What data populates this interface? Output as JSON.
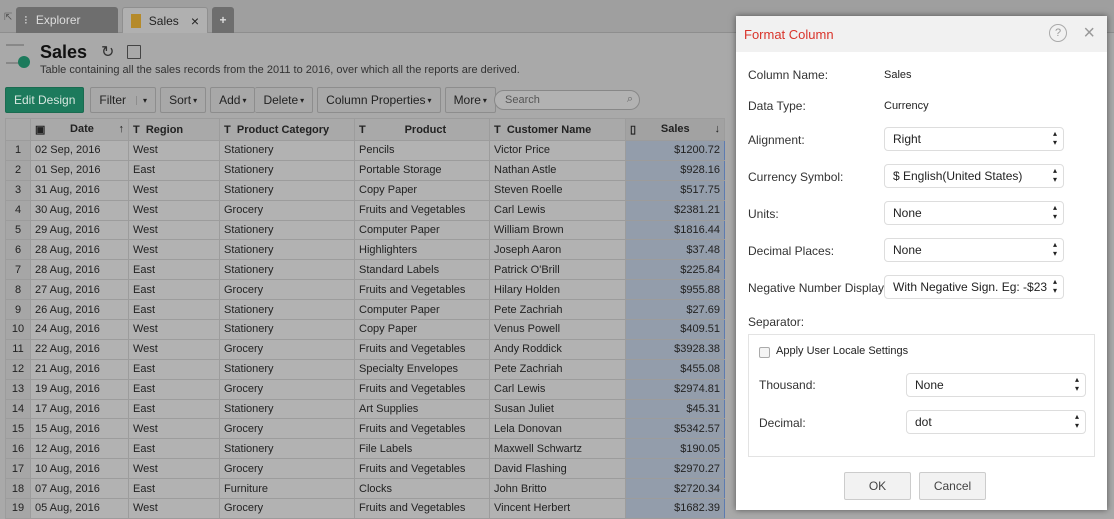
{
  "tabs": {
    "explorer": "Explorer",
    "sales": "Sales",
    "close": "×",
    "add": "+"
  },
  "header": {
    "title": "Sales",
    "description": "Table containing all the sales records from the 2011 to 2016, over which all the reports are derived."
  },
  "toolbar": {
    "edit_design": "Edit Design",
    "filter": "Filter",
    "sort": "Sort",
    "add": "Add",
    "delete": "Delete",
    "column_properties": "Column Properties",
    "more": "More",
    "search_placeholder": "Search"
  },
  "table": {
    "columns": [
      "Date",
      "Region",
      "Product Category",
      "Product",
      "Customer Name",
      "Sales"
    ],
    "rows": [
      [
        "1",
        "02 Sep, 2016",
        "West",
        "Stationery",
        "Pencils",
        "Victor Price",
        "$1200.72"
      ],
      [
        "2",
        "01 Sep, 2016",
        "East",
        "Stationery",
        "Portable Storage",
        "Nathan Astle",
        "$928.16"
      ],
      [
        "3",
        "31 Aug, 2016",
        "West",
        "Stationery",
        "Copy Paper",
        "Steven Roelle",
        "$517.75"
      ],
      [
        "4",
        "30 Aug, 2016",
        "West",
        "Grocery",
        "Fruits and Vegetables",
        "Carl Lewis",
        "$2381.21"
      ],
      [
        "5",
        "29 Aug, 2016",
        "West",
        "Stationery",
        "Computer Paper",
        "William Brown",
        "$1816.44"
      ],
      [
        "6",
        "28 Aug, 2016",
        "West",
        "Stationery",
        "Highlighters",
        "Joseph Aaron",
        "$37.48"
      ],
      [
        "7",
        "28 Aug, 2016",
        "East",
        "Stationery",
        "Standard Labels",
        "Patrick O'Brill",
        "$225.84"
      ],
      [
        "8",
        "27 Aug, 2016",
        "East",
        "Grocery",
        "Fruits and Vegetables",
        "Hilary Holden",
        "$955.88"
      ],
      [
        "9",
        "26 Aug, 2016",
        "East",
        "Stationery",
        "Computer Paper",
        "Pete Zachriah",
        "$27.69"
      ],
      [
        "10",
        "24 Aug, 2016",
        "West",
        "Stationery",
        "Copy Paper",
        "Venus Powell",
        "$409.51"
      ],
      [
        "11",
        "22 Aug, 2016",
        "West",
        "Grocery",
        "Fruits and Vegetables",
        "Andy Roddick",
        "$3928.38"
      ],
      [
        "12",
        "21 Aug, 2016",
        "East",
        "Stationery",
        "Specialty Envelopes",
        "Pete Zachriah",
        "$455.08"
      ],
      [
        "13",
        "19 Aug, 2016",
        "East",
        "Grocery",
        "Fruits and Vegetables",
        "Carl Lewis",
        "$2974.81"
      ],
      [
        "14",
        "17 Aug, 2016",
        "East",
        "Stationery",
        "Art Supplies",
        "Susan Juliet",
        "$45.31"
      ],
      [
        "15",
        "15 Aug, 2016",
        "West",
        "Grocery",
        "Fruits and Vegetables",
        "Lela Donovan",
        "$5342.57"
      ],
      [
        "16",
        "12 Aug, 2016",
        "East",
        "Stationery",
        "File Labels",
        "Maxwell Schwartz",
        "$190.05"
      ],
      [
        "17",
        "10 Aug, 2016",
        "West",
        "Grocery",
        "Fruits and Vegetables",
        "David Flashing",
        "$2970.27"
      ],
      [
        "18",
        "07 Aug, 2016",
        "East",
        "Furniture",
        "Clocks",
        "John Britto",
        "$2720.34"
      ],
      [
        "19",
        "05 Aug, 2016",
        "West",
        "Grocery",
        "Fruits and Vegetables",
        "Vincent Herbert",
        "$1682.39"
      ]
    ]
  },
  "dialog": {
    "title": "Format Column",
    "help": "?",
    "close": "×",
    "column_name_label": "Column Name:",
    "column_name": "Sales",
    "data_type_label": "Data Type:",
    "data_type": "Currency",
    "alignment_label": "Alignment:",
    "alignment": "Right",
    "currency_label": "Currency Symbol:",
    "currency": "$ English(United States)",
    "units_label": "Units:",
    "units": "None",
    "decimal_places_label": "Decimal Places:",
    "decimal_places": "None",
    "negative_label": "Negative Number Display:",
    "negative": "With Negative Sign. Eg: -$23",
    "separator_label": "Separator:",
    "locale_label": "Apply User Locale Settings",
    "locale_checked": false,
    "thousand_label": "Thousand:",
    "thousand": "None",
    "decimal_label": "Decimal:",
    "decimal": "dot",
    "ok": "OK",
    "cancel": "Cancel"
  },
  "colors": {
    "accent": "#1c7a5c",
    "dialog_title": "#d9342b"
  }
}
